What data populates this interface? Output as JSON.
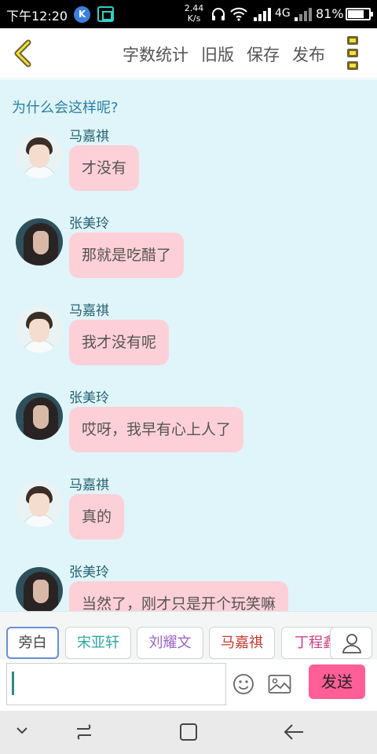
{
  "status_bar": {
    "time": "下午12:20",
    "net_speed_value": "2.44",
    "net_speed_unit": "K/s",
    "network_type": "4G",
    "battery_percent": "81%",
    "battery_level": 0.81,
    "icons": [
      "k-app-icon",
      "scanner-icon",
      "headset-icon",
      "wifi-icon",
      "signal-icon",
      "battery-icon"
    ]
  },
  "toolbar": {
    "back_icon": "chevron-left-icon",
    "word_count": "字数统计",
    "old_version": "旧版",
    "save": "保存",
    "publish": "发布",
    "more_icon": "more-vertical-icon"
  },
  "chat": {
    "narration": "为什么会这样呢?",
    "messages": [
      {
        "name": "马嘉祺",
        "text": "才没有"
      },
      {
        "name": "张美玲",
        "text": "那就是吃醋了"
      },
      {
        "name": "马嘉祺",
        "text": "我才没有呢"
      },
      {
        "name": "张美玲",
        "text": "哎呀，我早有心上人了"
      },
      {
        "name": "马嘉祺",
        "text": "真的"
      },
      {
        "name": "张美玲",
        "text": "当然了，刚才只是开个玩笑嘛"
      }
    ]
  },
  "roles": {
    "items": [
      {
        "label": "旁白",
        "color": "#444444"
      },
      {
        "label": "宋亚轩",
        "color": "#2ba8a0"
      },
      {
        "label": "刘耀文",
        "color": "#9b63c7"
      },
      {
        "label": "马嘉祺",
        "color": "#c53a2f"
      },
      {
        "label": "丁程鑫",
        "color": "#d23c85"
      }
    ],
    "person_icon": "person-icon"
  },
  "input": {
    "value": "",
    "emoji_icon": "emoji-icon",
    "image_icon": "image-icon",
    "send_label": "发送"
  },
  "nav_bar": {
    "icons": [
      "chevron-down-icon",
      "recent-apps-icon",
      "home-icon",
      "back-arrow-icon"
    ]
  }
}
